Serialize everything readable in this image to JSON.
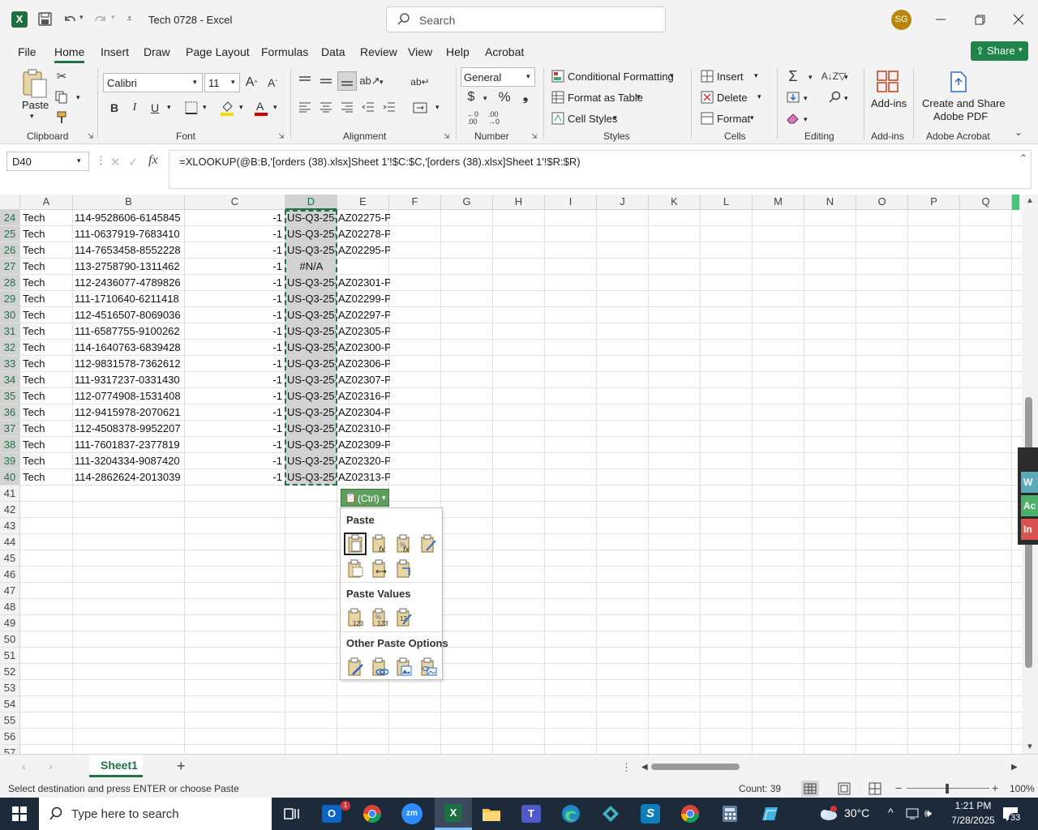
{
  "titlebar": {
    "doc_title": "Tech 0728  -  Excel",
    "search_placeholder": "Search",
    "avatar_initials": "SG"
  },
  "menu_tabs": [
    "File",
    "Home",
    "Insert",
    "Draw",
    "Page Layout",
    "Formulas",
    "Data",
    "Review",
    "View",
    "Help",
    "Acrobat"
  ],
  "active_tab": "Home",
  "share_label": "Share",
  "ribbon": {
    "paste": "Paste",
    "clipboard": "Clipboard",
    "font_name": "Calibri",
    "font_size": "11",
    "font": "Font",
    "alignment": "Alignment",
    "number_format": "General",
    "number": "Number",
    "conditional_formatting": "Conditional Formatting",
    "format_as_table": "Format as Table",
    "cell_styles": "Cell Styles",
    "styles": "Styles",
    "insert": "Insert",
    "delete": "Delete",
    "format": "Format",
    "cells": "Cells",
    "editing": "Editing",
    "addins_btn": "Add-ins",
    "addins": "Add-ins",
    "create_share_1": "Create and Share",
    "create_share_2": "Adobe PDF",
    "adobe_acrobat": "Adobe Acrobat"
  },
  "formula_bar": {
    "name_box": "D40",
    "formula": "=XLOOKUP(@B:B,'[orders (38).xlsx]Sheet 1'!$C:$C,'[orders (38).xlsx]Sheet 1'!$R:$R)"
  },
  "columns": [
    "A",
    "B",
    "C",
    "D",
    "E",
    "F",
    "G",
    "H",
    "I",
    "J",
    "K",
    "L",
    "M",
    "N",
    "O",
    "P",
    "Q"
  ],
  "rows": [
    {
      "n": "24",
      "a": "Tech",
      "b": "114-9528606-6145845",
      "c": "-1",
      "d": "US-Q3-25-",
      "e": "AZ02275-P"
    },
    {
      "n": "25",
      "a": "Tech",
      "b": "111-0637919-7683410",
      "c": "-1",
      "d": "US-Q3-25-",
      "e": "AZ02278-P"
    },
    {
      "n": "26",
      "a": "Tech",
      "b": "114-7653458-8552228",
      "c": "-1",
      "d": "US-Q3-25-",
      "e": "AZ02295-P"
    },
    {
      "n": "27",
      "a": "Tech",
      "b": "113-2758790-1311462",
      "c": "-1",
      "d": "#N/A",
      "e": ""
    },
    {
      "n": "28",
      "a": "Tech",
      "b": "112-2436077-4789826",
      "c": "-1",
      "d": "US-Q3-25-",
      "e": "AZ02301-P"
    },
    {
      "n": "29",
      "a": "Tech",
      "b": "111-1710640-6211418",
      "c": "-1",
      "d": "US-Q3-25-",
      "e": "AZ02299-P"
    },
    {
      "n": "30",
      "a": "Tech",
      "b": "112-4516507-8069036",
      "c": "-1",
      "d": "US-Q3-25-",
      "e": "AZ02297-P"
    },
    {
      "n": "31",
      "a": "Tech",
      "b": "111-6587755-9100262",
      "c": "-1",
      "d": "US-Q3-25-",
      "e": "AZ02305-P"
    },
    {
      "n": "32",
      "a": "Tech",
      "b": "114-1640763-6839428",
      "c": "-1",
      "d": "US-Q3-25-",
      "e": "AZ02300-P"
    },
    {
      "n": "33",
      "a": "Tech",
      "b": "112-9831578-7362612",
      "c": "-1",
      "d": "US-Q3-25-",
      "e": "AZ02306-P"
    },
    {
      "n": "34",
      "a": "Tech",
      "b": "111-9317237-0331430",
      "c": "-1",
      "d": "US-Q3-25-",
      "e": "AZ02307-P"
    },
    {
      "n": "35",
      "a": "Tech",
      "b": "112-0774908-1531408",
      "c": "-1",
      "d": "US-Q3-25-",
      "e": "AZ02316-P"
    },
    {
      "n": "36",
      "a": "Tech",
      "b": "112-9415978-2070621",
      "c": "-1",
      "d": "US-Q3-25-",
      "e": "AZ02304-P"
    },
    {
      "n": "37",
      "a": "Tech",
      "b": "112-4508378-9952207",
      "c": "-1",
      "d": "US-Q3-25-",
      "e": "AZ02310-P"
    },
    {
      "n": "38",
      "a": "Tech",
      "b": "111-7601837-2377819",
      "c": "-1",
      "d": "US-Q3-25-",
      "e": "AZ02309-P"
    },
    {
      "n": "39",
      "a": "Tech",
      "b": "111-3204334-9087420",
      "c": "-1",
      "d": "US-Q3-25-",
      "e": "AZ02320-P"
    },
    {
      "n": "40",
      "a": "Tech",
      "b": "114-2862624-2013039",
      "c": "-1",
      "d": "US-Q3-25-",
      "e": "AZ02313-P"
    }
  ],
  "empty_rows": [
    "41",
    "42",
    "43",
    "44",
    "45",
    "46",
    "47",
    "48",
    "49",
    "50",
    "51",
    "52",
    "53",
    "54",
    "55",
    "56",
    "57"
  ],
  "paste_menu": {
    "button": "(Ctrl)",
    "paste_header": "Paste",
    "values_header": "Paste Values",
    "other_header": "Other Paste Options"
  },
  "sheet_tab": "Sheet1",
  "side_tags": [
    "W",
    "Ac",
    "In"
  ],
  "status": {
    "message": "Select destination and press ENTER or choose Paste",
    "count": "Count: 39",
    "zoom": "100%"
  },
  "taskbar": {
    "search_placeholder": "Type here to search",
    "weather": "30°C",
    "time": "1:21 PM",
    "date": "7/28/2025",
    "notifications": "33",
    "mail_badge": "1"
  },
  "colors": {
    "excel_green": "#217346",
    "share_green": "#1e8449",
    "selection_border": "#217346"
  }
}
